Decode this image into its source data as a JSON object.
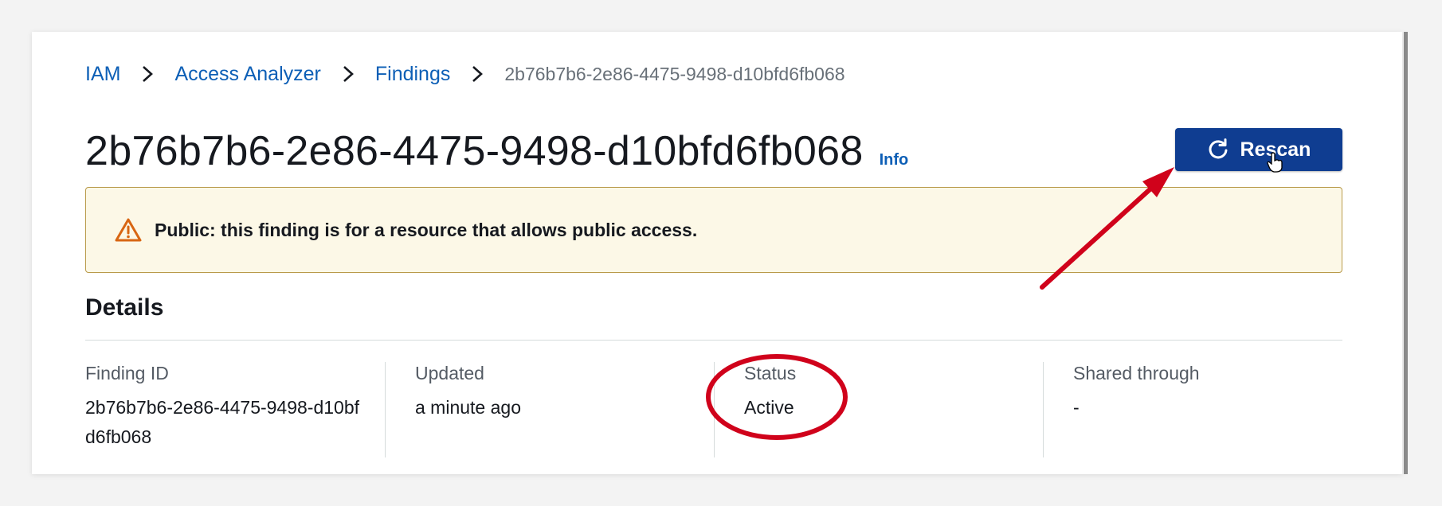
{
  "breadcrumb": {
    "items": [
      "IAM",
      "Access Analyzer",
      "Findings"
    ],
    "current": "2b76b7b6-2e86-4475-9498-d10bfd6fb068"
  },
  "header": {
    "title": "2b76b7b6-2e86-4475-9498-d10bfd6fb068",
    "info_label": "Info",
    "rescan_label": "Rescan"
  },
  "alert": {
    "type": "warning",
    "message": "Public: this finding is for a resource that allows public access."
  },
  "details": {
    "heading": "Details",
    "fields": [
      {
        "label": "Finding ID",
        "value": "2b76b7b6-2e86-4475-9498-d10bfd6fb068"
      },
      {
        "label": "Updated",
        "value": "a minute ago"
      },
      {
        "label": "Status",
        "value": "Active"
      },
      {
        "label": "Shared through",
        "value": "-"
      }
    ]
  },
  "colors": {
    "link": "#0d5fb6",
    "primary_button": "#0f3d91",
    "warning_bg": "#fcf8e7",
    "warning_border": "#b99a4a",
    "warning_icon": "#d86613",
    "annotation_red": "#d0021b"
  },
  "icons": {
    "breadcrumb_separator": "chevron-right-icon",
    "rescan": "refresh-icon",
    "alert": "warning-triangle-icon",
    "cursor": "hand-pointer-icon"
  }
}
